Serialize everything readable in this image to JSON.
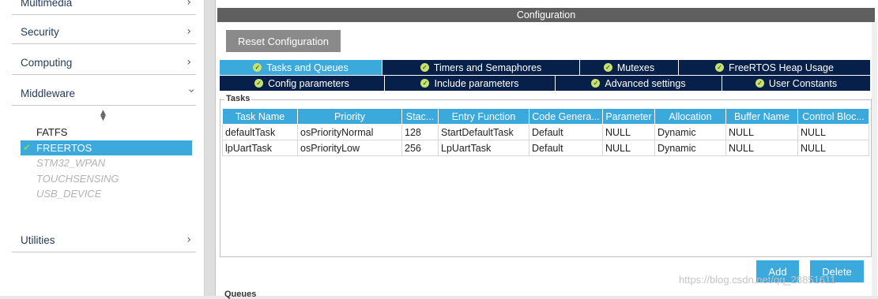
{
  "sidebar": {
    "categories": [
      {
        "label": "Multimedia"
      },
      {
        "label": "Security"
      },
      {
        "label": "Computing"
      },
      {
        "label": "Middleware"
      },
      {
        "label": "Utilities"
      }
    ],
    "middleware_items": [
      {
        "label": "FATFS",
        "state": "enabled"
      },
      {
        "label": "FREERTOS",
        "state": "selected-checked"
      },
      {
        "label": "STM32_WPAN",
        "state": "disabled"
      },
      {
        "label": "TOUCHSENSING",
        "state": "disabled"
      },
      {
        "label": "USB_DEVICE",
        "state": "disabled"
      }
    ]
  },
  "config": {
    "header": "Configuration",
    "reset_label": "Reset Configuration",
    "tabs_row1": [
      {
        "label": "Tasks and Queues",
        "active": true
      },
      {
        "label": "Timers and Semaphores"
      },
      {
        "label": "Mutexes"
      },
      {
        "label": "FreeRTOS Heap Usage"
      }
    ],
    "tabs_row2": [
      {
        "label": "Config parameters"
      },
      {
        "label": "Include parameters"
      },
      {
        "label": "Advanced settings"
      },
      {
        "label": "User Constants"
      }
    ],
    "tasks_group_label": "Tasks",
    "columns": [
      "Task Name",
      "Priority",
      "Stac...",
      "Entry Function",
      "Code Genera...",
      "Parameter",
      "Allocation",
      "Buffer Name",
      "Control Bloc..."
    ],
    "rows": [
      [
        "defaultTask",
        "osPriorityNormal",
        "128",
        "StartDefaultTask",
        "Default",
        "NULL",
        "Dynamic",
        "NULL",
        "NULL"
      ],
      [
        "lpUartTask",
        "osPriorityLow",
        "256",
        "LpUartTask",
        "Default",
        "NULL",
        "Dynamic",
        "NULL",
        "NULL"
      ]
    ],
    "add_label": "Add",
    "delete_label": "Delete",
    "queues_label": "Queues"
  },
  "watermark": "https://blog.csdn.net/qq_28851611",
  "colors": {
    "accent": "#3ca9dd",
    "tab_dark": "#07204a",
    "header_bg": "#5f5f5f",
    "check_green": "#7ed957"
  },
  "icons": {
    "chevron_right": "chevron-right-icon",
    "chevron_down": "chevron-down-icon",
    "sort": "sort-icon",
    "check": "check-icon",
    "tab_ok": "check-circle-icon"
  }
}
